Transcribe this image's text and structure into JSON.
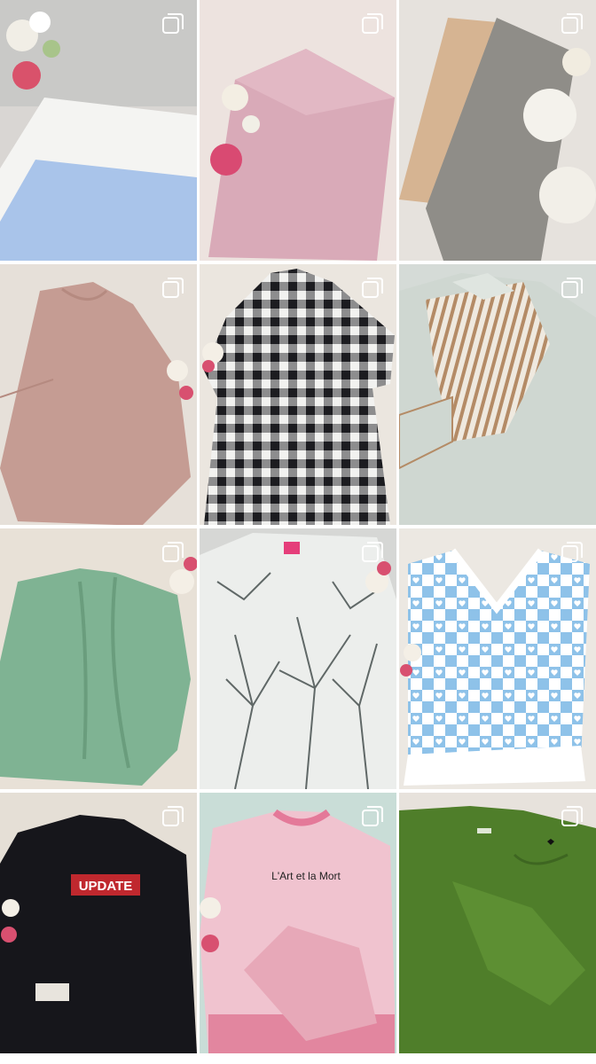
{
  "grid": {
    "posts": [
      {
        "subject": "folded fabrics white blue",
        "multi": true,
        "icon": "multiple-photos-icon"
      },
      {
        "subject": "folded pink fabric",
        "multi": true,
        "icon": "multiple-photos-icon"
      },
      {
        "subject": "folded tan and grey fabrics",
        "multi": true,
        "icon": "multiple-photos-icon"
      },
      {
        "subject": "pink long sleeve dress",
        "multi": true,
        "icon": "multiple-photos-icon"
      },
      {
        "subject": "black white gingham shirt",
        "multi": true,
        "icon": "multiple-photos-icon"
      },
      {
        "subject": "striped collar blouse",
        "multi": true,
        "icon": "multiple-photos-icon"
      },
      {
        "subject": "green ruffle cardigan",
        "multi": true,
        "icon": "multiple-photos-icon"
      },
      {
        "subject": "tree print blouse",
        "multi": true,
        "icon": "multiple-photos-icon"
      },
      {
        "subject": "blue heart knit vest",
        "multi": true,
        "icon": "multiple-photos-icon"
      },
      {
        "subject": "black update sweatshirt",
        "multi": true,
        "icon": "multiple-photos-icon",
        "print_text": "UPDATE"
      },
      {
        "subject": "pink slogan sweatshirt",
        "multi": true,
        "icon": "multiple-photos-icon",
        "print_text": "L'Art et la Mort"
      },
      {
        "subject": "green sweatshirt",
        "multi": true,
        "icon": "multiple-photos-icon"
      }
    ]
  },
  "colors": {
    "background": "#ffffff",
    "icon": "#ffffff"
  }
}
